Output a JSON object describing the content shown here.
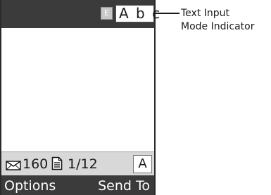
{
  "top_bar": {
    "dictionary_indicator": "E",
    "input_mode": "A b c"
  },
  "status_bar": {
    "character_count": "160",
    "page_count": "1/12",
    "case_indicator": "A",
    "message_icon": "envelope-icon",
    "page_icon": "document-icon"
  },
  "softkeys": {
    "left_label": "Options",
    "right_label": "Send To"
  },
  "callout": {
    "line1": "Text Input",
    "line2": "Mode Indicator"
  }
}
